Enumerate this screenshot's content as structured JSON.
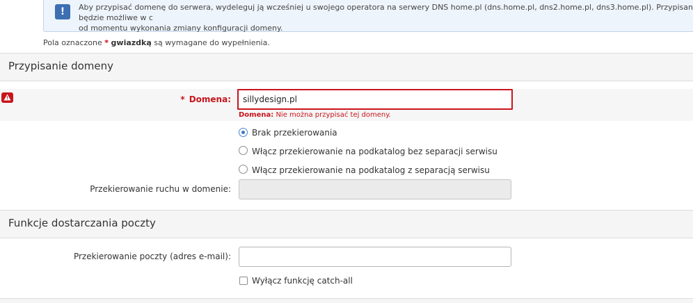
{
  "info": {
    "icon": "info-icon",
    "line1": "Aby przypisać domenę do serwera, wydeleguj ją wcześniej u swojego operatora na serwery DNS home.pl (dns.home.pl, dns2.home.pl, dns3.home.pl). Przypisanie będzie możliwe w c",
    "line2": "od momentu wykonania zmiany konfiguracji domeny."
  },
  "required_note": {
    "prefix": "Pola oznaczone",
    "star": "*",
    "bold": "gwiazdką",
    "suffix": "są wymagane do wypełnienia."
  },
  "section_domain": {
    "title": "Przypisanie domeny",
    "domain_label": "Domena:",
    "domain_star": "*",
    "domain_value": "sillydesign.pl",
    "error_field": "Domena:",
    "error_text": "Nie można przypisać tej domeny.",
    "redirect_options": [
      {
        "label": "Brak przekierowania",
        "checked": true
      },
      {
        "label": "Włącz przekierowanie na podkatalog bez separacji serwisu",
        "checked": false
      },
      {
        "label": "Włącz przekierowanie na podkatalog z separacją serwisu",
        "checked": false
      }
    ],
    "traffic_label": "Przekierowanie ruchu w domenie:",
    "traffic_value": ""
  },
  "section_mail": {
    "title": "Funkcje dostarczania poczty",
    "mail_label": "Przekierowanie poczty (adres e-mail):",
    "mail_value": "",
    "catchall_label": "Wyłącz funkcję catch-all",
    "catchall_checked": false
  },
  "colors": {
    "error": "#c9141c",
    "accent": "#3b78c4",
    "info_bg": "#eef4fb"
  }
}
